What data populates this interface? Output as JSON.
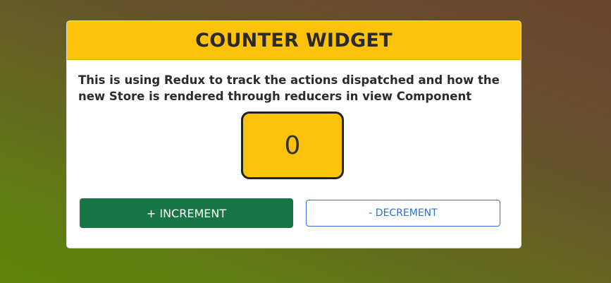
{
  "widget": {
    "title": "COUNTER WIDGET",
    "description": "This is using Redux to track the actions dispatched and how the new Store is rendered through reducers in view Component",
    "counter_value": "0",
    "increment_label": "+ INCREMENT",
    "decrement_label": "- DECREMENT"
  },
  "colors": {
    "header_bg": "#fdc20a",
    "counter_bg": "#fdc20a",
    "increment_bg": "#187545",
    "decrement_accent": "#2f6fd6"
  }
}
